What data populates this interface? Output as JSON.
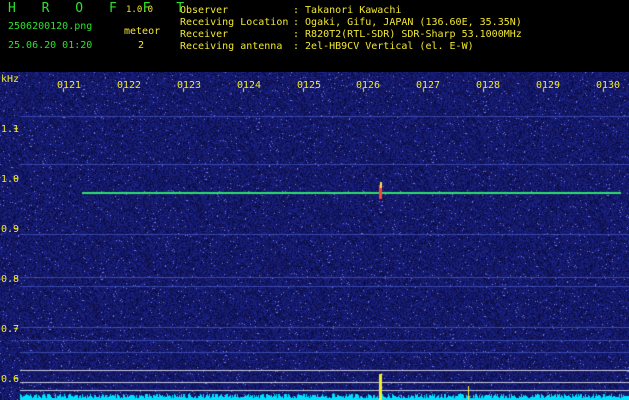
{
  "app": {
    "name": "H R O F F T",
    "version": "1.0.0"
  },
  "file": {
    "name": "2506200120.png",
    "timestamp": "25.06.20 01:20"
  },
  "counter": {
    "label": "meteor",
    "value": "2"
  },
  "info": [
    {
      "label": "Observer",
      "value": ": Takanori Kawachi"
    },
    {
      "label": "Receiving Location",
      "value": ": Ogaki, Gifu, JAPAN (136.60E, 35.35N)"
    },
    {
      "label": "Receiver",
      "value": ": R820T2(RTL-SDR) SDR-Sharp 53.1000MHz"
    },
    {
      "label": "Receiving antenna",
      "value": ": 2el-HB9CV Vertical (el. E-W)"
    }
  ],
  "axis": {
    "unit": "kHz",
    "time_labels": [
      "0121",
      "0122",
      "0123",
      "0124",
      "0125",
      "0126",
      "0127",
      "0128",
      "0129",
      "0130"
    ],
    "freq_labels": [
      "1.1",
      "1.0",
      "0.9",
      "0.8",
      "0.7",
      "0.6"
    ]
  },
  "colors": {
    "background": "#000000",
    "noise": "#10106a",
    "carrier": "#30e070",
    "label": "#f2e830",
    "spectrum": "#00e0ff",
    "meteor": "#ff4040"
  }
}
